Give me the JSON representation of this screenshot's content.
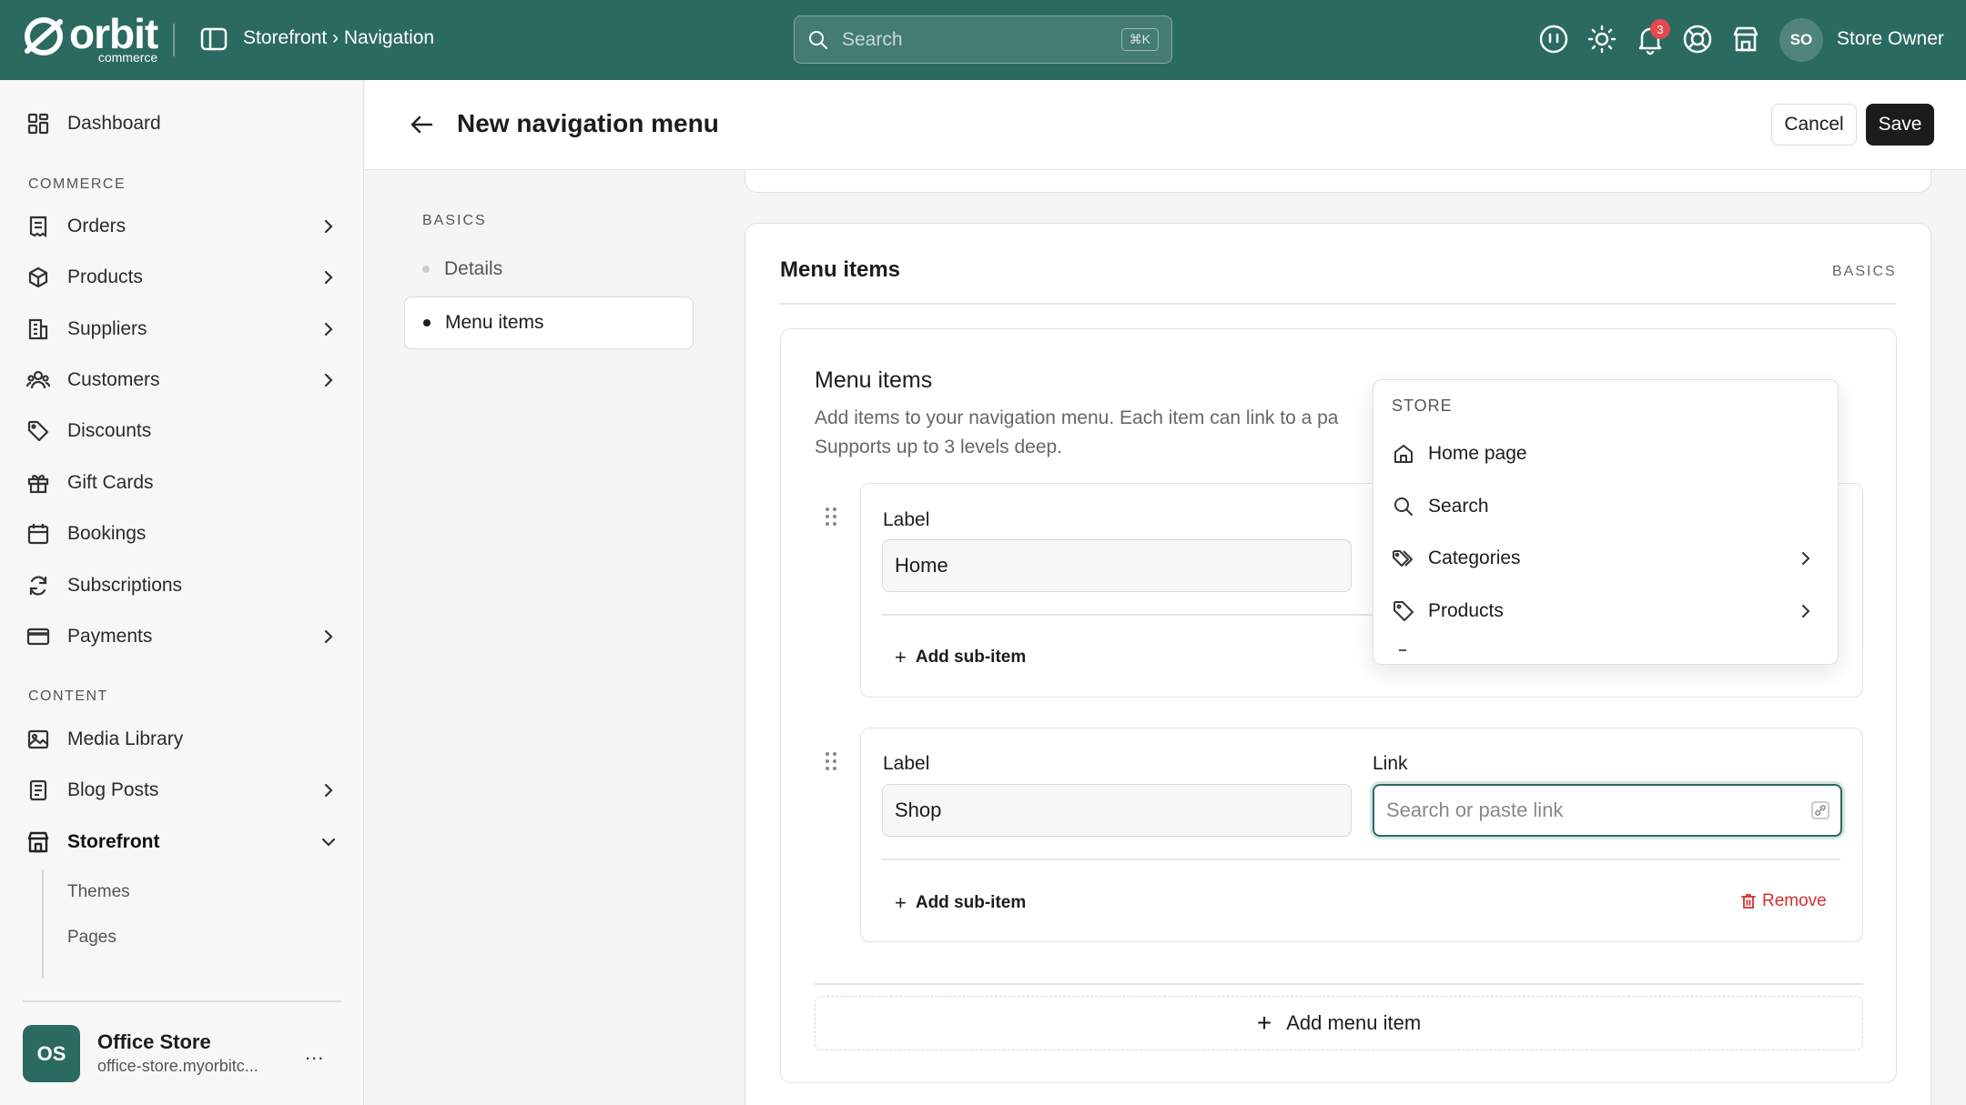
{
  "app": {
    "logo_text": "orbit",
    "logo_sub": "commerce",
    "breadcrumb": "Storefront › Navigation",
    "search_placeholder": "Search",
    "search_shortcut": "⌘K",
    "notification_count": "3",
    "user_initials": "SO",
    "user_name": "Store Owner",
    "brand_color": "#2b6a61"
  },
  "sidebar": {
    "dashboard": "Dashboard",
    "commerce_label": "COMMERCE",
    "orders": "Orders",
    "products": "Products",
    "suppliers": "Suppliers",
    "customers": "Customers",
    "discounts": "Discounts",
    "gift_cards": "Gift Cards",
    "bookings": "Bookings",
    "subscriptions": "Subscriptions",
    "payments": "Payments",
    "content_label": "CONTENT",
    "media_library": "Media Library",
    "blog_posts": "Blog Posts",
    "storefront": "Storefront",
    "sub_themes": "Themes",
    "sub_pages": "Pages",
    "store_initials": "OS",
    "store_name": "Office Store",
    "store_url": "office-store.myorbitc...",
    "store_more": "..."
  },
  "header": {
    "title": "New navigation menu",
    "cancel": "Cancel",
    "save": "Save"
  },
  "toc": {
    "label": "BASICS",
    "items": [
      "Details",
      "Menu items"
    ]
  },
  "card": {
    "title": "Menu items",
    "tag": "BASICS",
    "inner_title": "Menu items",
    "inner_desc_1": "Add items to your navigation menu. Each item can link to a pa",
    "inner_desc_2": "Supports up to 3 levels deep.",
    "items": [
      {
        "label_caption": "Label",
        "label_value": "Home",
        "add_sub": "Add sub-item"
      },
      {
        "label_caption": "Label",
        "label_value": "Shop",
        "link_caption": "Link",
        "link_placeholder": "Search or paste link",
        "add_sub": "Add sub-item",
        "remove": "Remove"
      }
    ],
    "add_menu_item": "Add menu item"
  },
  "dropdown": {
    "heading": "STORE",
    "items": [
      {
        "label": "Home page",
        "icon": "home-icon"
      },
      {
        "label": "Search",
        "icon": "search-icon"
      },
      {
        "label": "Categories",
        "icon": "tags-icon"
      },
      {
        "label": "Products",
        "icon": "tag-icon"
      }
    ]
  }
}
